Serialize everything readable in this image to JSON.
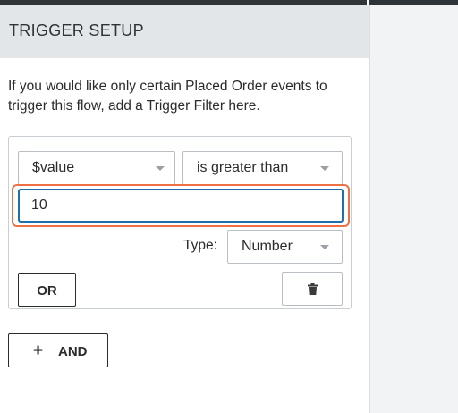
{
  "panel": {
    "title": "TRIGGER SETUP",
    "description": "If you would like only certain Placed Order events to trigger this flow, add a Trigger Filter here."
  },
  "filter": {
    "property_select": {
      "value": "$value",
      "icon": "chevron-down-icon"
    },
    "operator_select": {
      "value": "is greater than",
      "icon": "chevron-down-icon"
    },
    "value_input": {
      "value": "10",
      "placeholder": ""
    },
    "type_label": "Type:",
    "type_select": {
      "value": "Number",
      "icon": "chevron-down-icon"
    },
    "or_button": "OR",
    "delete_button": {
      "icon": "trash-icon"
    }
  },
  "and_button": {
    "icon": "plus-icon",
    "label": "AND"
  },
  "colors": {
    "header_bg": "#e3e6e8",
    "focus_ring": "#ee7143",
    "input_border_focus": "#1f6fa8",
    "right_pane_bg": "#f2f3f4",
    "top_bar": "#2f3438"
  }
}
